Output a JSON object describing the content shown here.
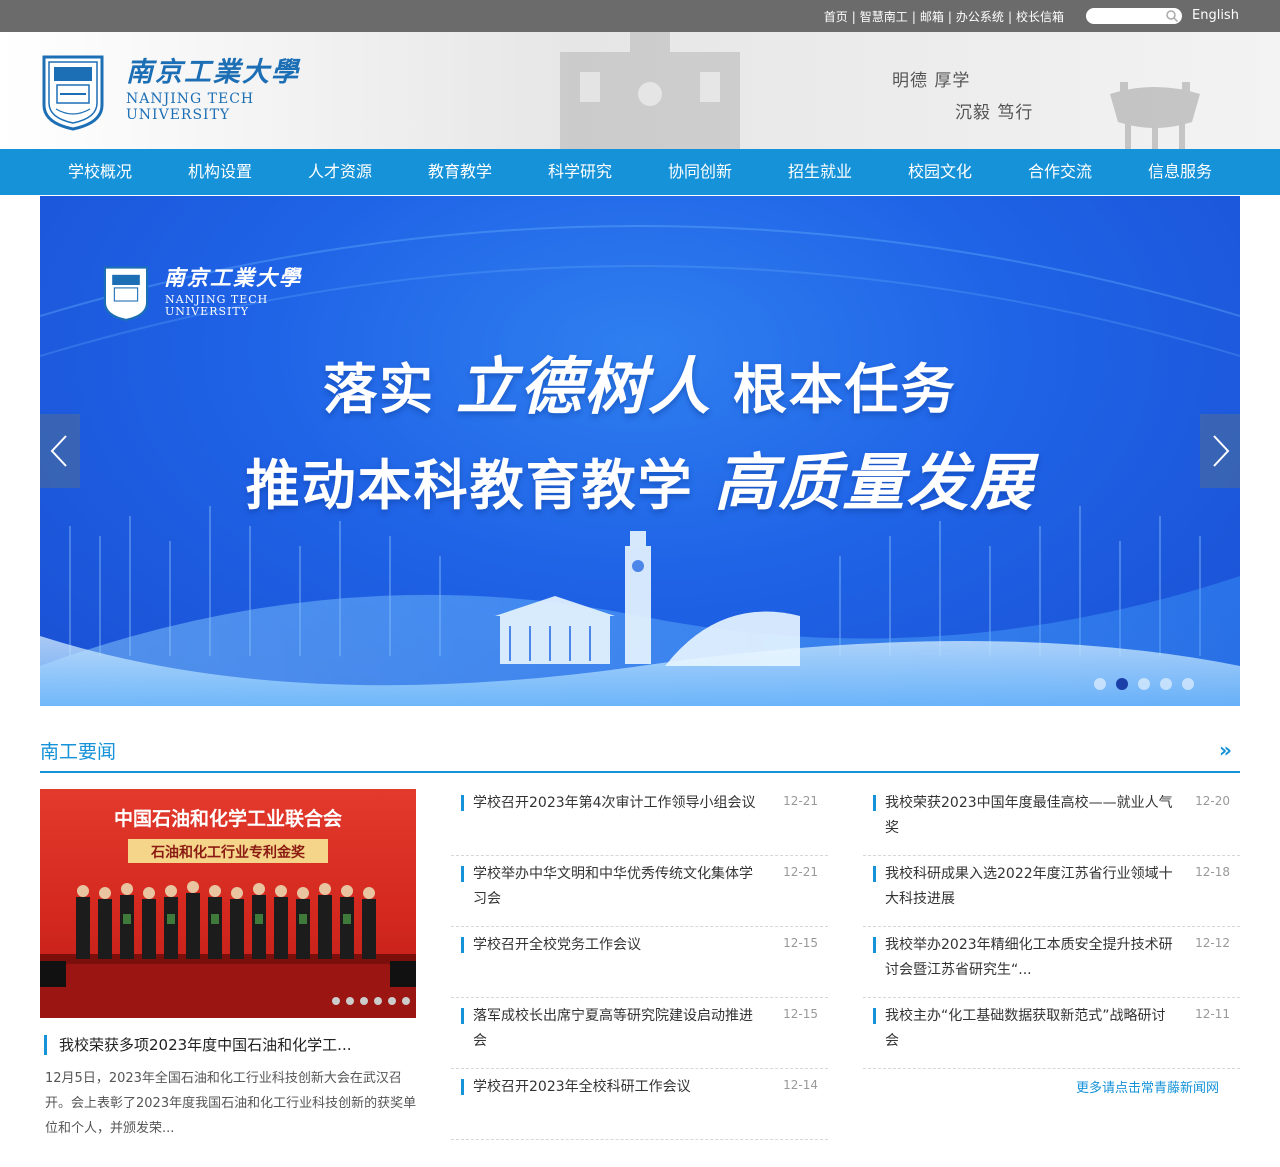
{
  "topbar": {
    "links": [
      "首页",
      "智慧南工",
      "邮箱",
      "办公系统",
      "校长信箱"
    ],
    "search_placeholder": "",
    "english_label": "English"
  },
  "header": {
    "logo_cn": "南京工業大學",
    "logo_en_line1": "NANJING TECH",
    "logo_en_line2": "UNIVERSITY",
    "motto_line1": "明德 厚学",
    "motto_line2": "沉毅 笃行"
  },
  "nav": {
    "items": [
      "学校概况",
      "机构设置",
      "人才资源",
      "教育教学",
      "科学研究",
      "协同创新",
      "招生就业",
      "校园文化",
      "合作交流",
      "信息服务"
    ]
  },
  "banner": {
    "logo_cn": "南京工業大學",
    "logo_en_line1": "NANJING TECH",
    "logo_en_line2": "UNIVERSITY",
    "line1_a": "落实",
    "line1_brush": "立德树人",
    "line1_b": "根本任务",
    "line2_a": "推动本科教育教学",
    "line2_brush": "高质量发展",
    "slide_count": 5,
    "active_slide": 1
  },
  "news": {
    "section_title": "南工要闻",
    "more_symbol": "»",
    "feature": {
      "image_banner_text": "中国石油和化学工业联合会",
      "image_sub_text": "石油和化工行业专利金奖",
      "title": "我校荣获多项2023年度中国石油和化学工...",
      "summary": "12月5日，2023年全国石油和化工行业科技创新大会在武汉召开。会上表彰了2023年度我国石油和化工行业科技创新的获奖单位和个人，并颁发荣..."
    },
    "column1": [
      {
        "title": "学校召开2023年第4次审计工作领导小组会议",
        "date": "12-21"
      },
      {
        "title": "学校举办中华文明和中华优秀传统文化集体学习会",
        "date": "12-21"
      },
      {
        "title": "学校召开全校党务工作会议",
        "date": "12-15"
      },
      {
        "title": "落军成校长出席宁夏高等研究院建设启动推进会",
        "date": "12-15"
      },
      {
        "title": "学校召开2023年全校科研工作会议",
        "date": "12-14"
      }
    ],
    "column2": [
      {
        "title": "我校荣获2023中国年度最佳高校——就业人气奖",
        "date": "12-20"
      },
      {
        "title": "我校科研成果入选2022年度江苏省行业领域十大科技进展",
        "date": "12-18"
      },
      {
        "title": "我校举办2023年精细化工本质安全提升技术研讨会暨江苏省研究生“...",
        "date": "12-12"
      },
      {
        "title": "我校主办“化工基础数据获取新范式”战略研讨会",
        "date": "12-11"
      }
    ],
    "more_link": "更多请点击常青藤新闻网"
  },
  "colors": {
    "accent": "#1592d8",
    "topbar": "#6b6b6b",
    "banner": "#1f63e6"
  }
}
